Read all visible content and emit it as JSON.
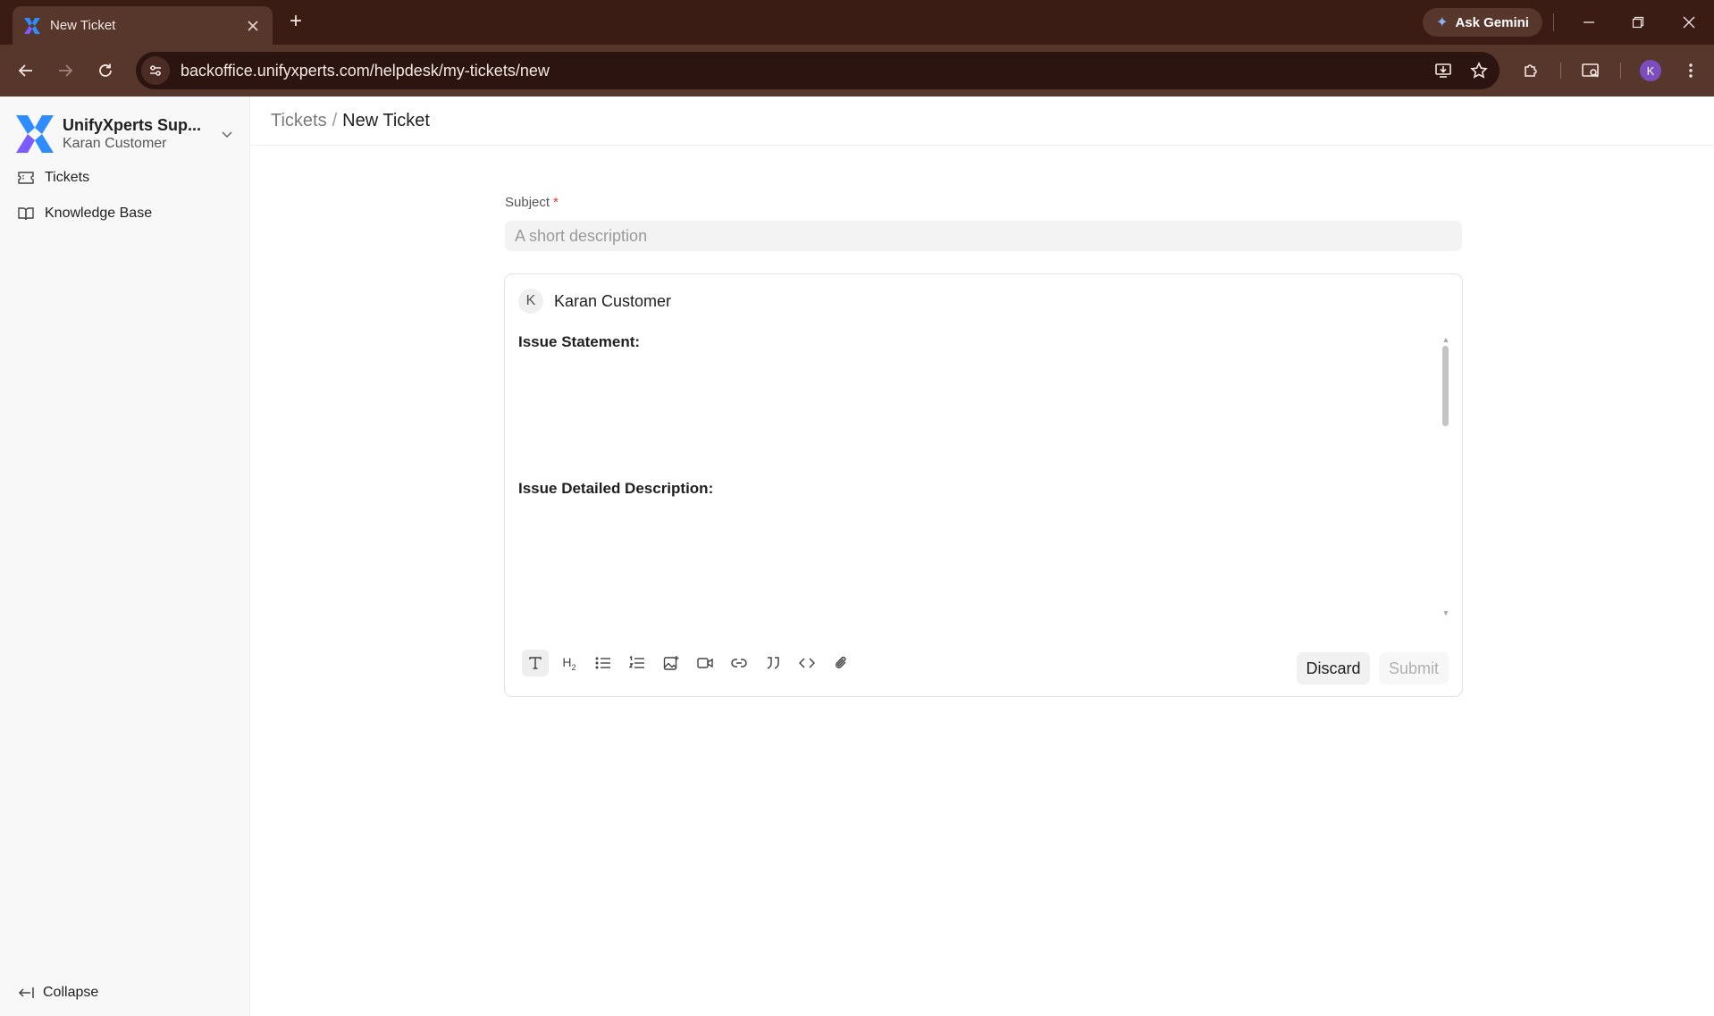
{
  "browser": {
    "tab_title": "New Ticket",
    "new_tab_symbol": "+",
    "ask_gemini_label": "Ask Gemini",
    "url": "backoffice.unifyxperts.com/helpdesk/my-tickets/new",
    "profile_initial": "K"
  },
  "sidebar": {
    "brand_name": "UnifyXperts Sup...",
    "brand_user": "Karan Customer",
    "items": [
      {
        "label": "Tickets",
        "icon": "ticket-icon"
      },
      {
        "label": "Knowledge Base",
        "icon": "book-icon"
      }
    ],
    "collapse_label": "Collapse"
  },
  "header": {
    "breadcrumb_parent": "Tickets",
    "breadcrumb_separator": "/",
    "breadcrumb_current": "New Ticket"
  },
  "form": {
    "subject_label": "Subject",
    "subject_required_mark": "*",
    "subject_placeholder": "A short description",
    "subject_value": ""
  },
  "editor": {
    "author_initial": "K",
    "author_name": "Karan Customer",
    "headings": [
      "Issue Statement:",
      "Issue Detailed Description:"
    ],
    "toolbar": [
      "text-icon",
      "heading-2-icon",
      "bullet-list-icon",
      "numbered-list-icon",
      "image-icon",
      "video-icon",
      "link-icon",
      "quote-icon",
      "code-icon",
      "attachment-icon"
    ],
    "discard_label": "Discard",
    "submit_label": "Submit"
  },
  "colors": {
    "chrome_dark": "#3b1c15",
    "chrome_mid": "#57362c",
    "required": "#e03636",
    "profile": "#7c4dbe"
  }
}
